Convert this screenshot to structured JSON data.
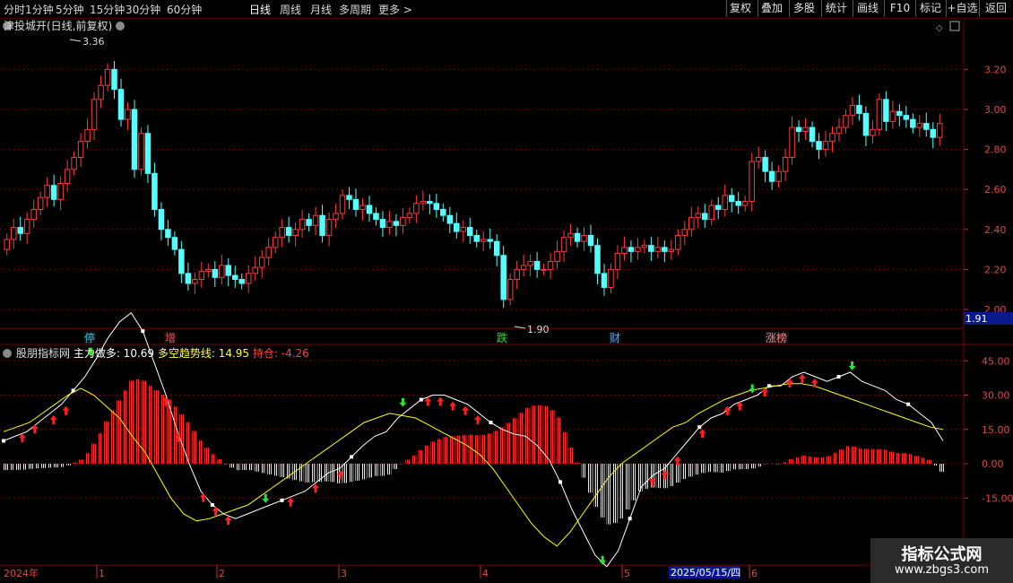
{
  "toolbar": {
    "tabs": [
      "分时",
      "1分钟",
      "5分钟",
      "15分钟",
      "30分钟",
      "60分钟",
      "日线",
      "周线",
      "月线",
      "多周期",
      "更多"
    ],
    "active_tab": "日线",
    "right_buttons": [
      "复权",
      "叠加",
      "多股",
      "统计",
      "画线",
      "F10",
      "+自选",
      "返回",
      "标记"
    ]
  },
  "stock": {
    "title": "津投城开(日线,前复权)"
  },
  "price_axis": {
    "ticks": [
      "3.20",
      "3.00",
      "2.80",
      "2.60",
      "2.40",
      "2.20",
      "2.00"
    ],
    "current": "1.91"
  },
  "annotations": {
    "high": "3.36",
    "low": "1.90"
  },
  "event_markers": [
    "停",
    "增",
    "跌",
    "财",
    "涨榜"
  ],
  "indicator": {
    "name": "股朋指标网",
    "l1_label": "主力做多:",
    "l1_value": "10.69",
    "l2_label": "多空趋势线:",
    "l2_value": "14.95",
    "l3_label": "持仓:",
    "l3_value": "-4.26"
  },
  "ind_axis": {
    "ticks": [
      "45.00",
      "30.00",
      "15.00",
      "0.00",
      "-15.00"
    ]
  },
  "timeline": {
    "year": "2024年",
    "months": [
      "1",
      "2",
      "3",
      "4",
      "5",
      "6"
    ],
    "cursor_date": "2025/05/15/四"
  },
  "watermark": {
    "line1": "指标公式网",
    "line2": "www.zbgs3.com"
  },
  "colors": {
    "up": "#ff3c3c",
    "down": "#54ffff",
    "white_line": "#ffffff",
    "trend_line": "#ffff00",
    "grid": "#7a0000"
  },
  "chart_data": {
    "type": "candlestick",
    "close": [
      2.35,
      2.41,
      2.38,
      2.45,
      2.5,
      2.56,
      2.62,
      2.55,
      2.63,
      2.7,
      2.76,
      2.84,
      2.9,
      3.05,
      3.12,
      3.2,
      3.1,
      2.95,
      3.0,
      2.7,
      2.88,
      2.68,
      2.5,
      2.4,
      2.36,
      2.3,
      2.18,
      2.13,
      2.15,
      2.19,
      2.2,
      2.16,
      2.22,
      2.17,
      2.15,
      2.13,
      2.18,
      2.21,
      2.26,
      2.31,
      2.36,
      2.41,
      2.37,
      2.4,
      2.45,
      2.42,
      2.47,
      2.37,
      2.45,
      2.48,
      2.57,
      2.55,
      2.5,
      2.52,
      2.48,
      2.45,
      2.41,
      2.44,
      2.42,
      2.46,
      2.48,
      2.53,
      2.54,
      2.53,
      2.5,
      2.47,
      2.43,
      2.39,
      2.41,
      2.37,
      2.34,
      2.35,
      2.34,
      2.27,
      2.05,
      2.15,
      2.2,
      2.22,
      2.24,
      2.2,
      2.2,
      2.24,
      2.29,
      2.36,
      2.38,
      2.34,
      2.37,
      2.32,
      2.18,
      2.11,
      2.2,
      2.28,
      2.31,
      2.29,
      2.31,
      2.32,
      2.29,
      2.31,
      2.29,
      2.3,
      2.37,
      2.4,
      2.46,
      2.48,
      2.45,
      2.52,
      2.5,
      2.57,
      2.54,
      2.52,
      2.54,
      2.74,
      2.76,
      2.69,
      2.64,
      2.69,
      2.76,
      2.91,
      2.89,
      2.91,
      2.84,
      2.8,
      2.84,
      2.88,
      2.91,
      2.97,
      3.02,
      2.98,
      2.87,
      2.9,
      3.05,
      2.94,
      2.99,
      2.97,
      2.95,
      2.91,
      2.93,
      2.9,
      2.86,
      2.93
    ],
    "white_line": [
      10,
      12,
      14,
      18,
      22,
      26,
      32,
      38,
      46,
      55,
      62,
      66,
      58,
      44,
      30,
      14,
      0,
      -12,
      -18,
      -22,
      -24,
      -22,
      -20,
      -18,
      -16,
      -14,
      -12,
      -8,
      -4,
      -2,
      3,
      8,
      12,
      14,
      20,
      24,
      28,
      30,
      30,
      28,
      26,
      22,
      18,
      15,
      13,
      12,
      8,
      2,
      -8,
      -20,
      -30,
      -40,
      -45,
      -38,
      -24,
      -10,
      -5,
      -2,
      4,
      10,
      16,
      20,
      22,
      26,
      28,
      30,
      34,
      34,
      38,
      40,
      38,
      36,
      38,
      40,
      36,
      34,
      32,
      28,
      26,
      22,
      18,
      10
    ],
    "trend_line": [
      14,
      16,
      18,
      22,
      26,
      30,
      33,
      30,
      25,
      20,
      12,
      5,
      -5,
      -15,
      -22,
      -25,
      -24,
      -22,
      -20,
      -18,
      -14,
      -10,
      -6,
      -2,
      2,
      6,
      10,
      14,
      18,
      20,
      22,
      21,
      20,
      17,
      14,
      11,
      8,
      4,
      -2,
      -10,
      -18,
      -26,
      -32,
      -36,
      -30,
      -22,
      -14,
      -6,
      0,
      4,
      8,
      12,
      16,
      18,
      22,
      25,
      28,
      30,
      32,
      33,
      34,
      35,
      35,
      34,
      32,
      30,
      28,
      26,
      24,
      22,
      20,
      18,
      16,
      15
    ]
  }
}
